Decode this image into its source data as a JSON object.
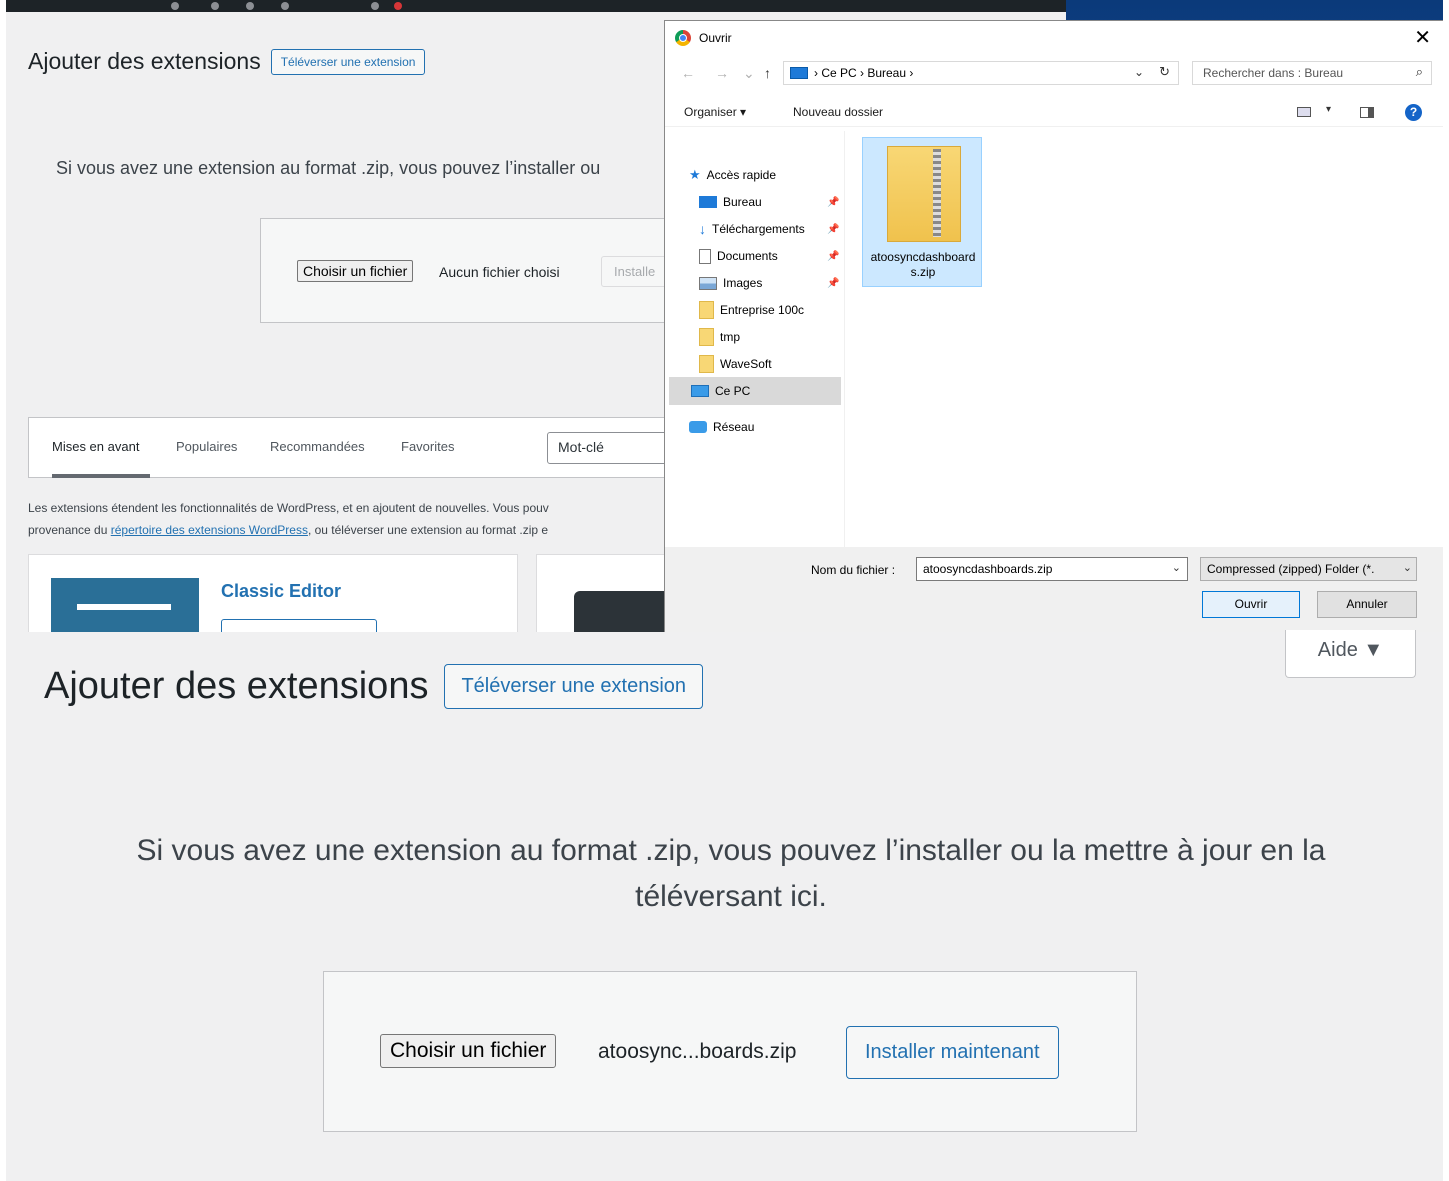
{
  "top": {
    "wp": {
      "title": "Ajouter des extensions",
      "upload_button": "Téléverser une extension",
      "upload_desc": "Si vous avez une extension au format .zip, vous pouvez l’installer ou",
      "choose_file": "Choisir un fichier",
      "no_file": "Aucun fichier choisi",
      "install_partial": "Installe",
      "tabs": [
        "Mises en avant",
        "Populaires",
        "Recommandées",
        "Favorites"
      ],
      "keyword": "Mot-clé",
      "info_line1": "Les extensions étendent les fonctionnalités de WordPress, et en ajoutent de nouvelles. Vous pouv",
      "info_line2_pre": "provenance du ",
      "info_link": "répertoire des extensions WordPress",
      "info_line2_post": ", ou téléverser une extension au format .zip e",
      "card_title": "Classic Editor"
    },
    "dialog": {
      "title": "Ouvrir",
      "close": "✕",
      "nav_back": "←",
      "nav_forward": "→",
      "nav_recent": "⌄",
      "nav_up": "↑",
      "breadcrumb": "›  Ce PC  ›  Bureau  ›",
      "addr_chevron": "⌄",
      "refresh": "↻",
      "search_placeholder": "Rechercher dans : Bureau",
      "search_glyph": "⌕",
      "organize": "Organiser ▾",
      "new_folder": "Nouveau dossier",
      "view_caret": "▾",
      "help": "?",
      "pin": "📌",
      "nav": {
        "quick_access": "Accès rapide",
        "bureau": "Bureau",
        "downloads": "Téléchargements",
        "documents": "Documents",
        "images": "Images",
        "entreprise": "Entreprise 100c",
        "tmp": "tmp",
        "wavesoft": "WaveSoft",
        "this_pc": "Ce PC",
        "network": "Réseau"
      },
      "file_name_display": "atoosyncdashboards.zip",
      "filename_label": "Nom du fichier :",
      "filename_value": "atoosyncdashboards.zip",
      "filetype": "Compressed (zipped) Folder (*.",
      "select_chevron": "⌄",
      "open_button": "Ouvrir",
      "cancel_button": "Annuler"
    }
  },
  "bottom": {
    "help_tab": "Aide ▼",
    "title": "Ajouter des extensions",
    "upload_button": "Téléverser une extension",
    "upload_desc": "Si vous avez une extension au format .zip, vous pouvez l’installer ou la mettre à jour en la téléversant ici.",
    "choose_file": "Choisir un fichier",
    "chosen_file": "atoosync...boards.zip",
    "install_button": "Installer maintenant"
  },
  "colors": {
    "wp_blue": "#2271b1",
    "page_bg": "#f0f0f1",
    "dialog_selected": "#cce8ff",
    "desktop_blue": "#124c9c"
  }
}
